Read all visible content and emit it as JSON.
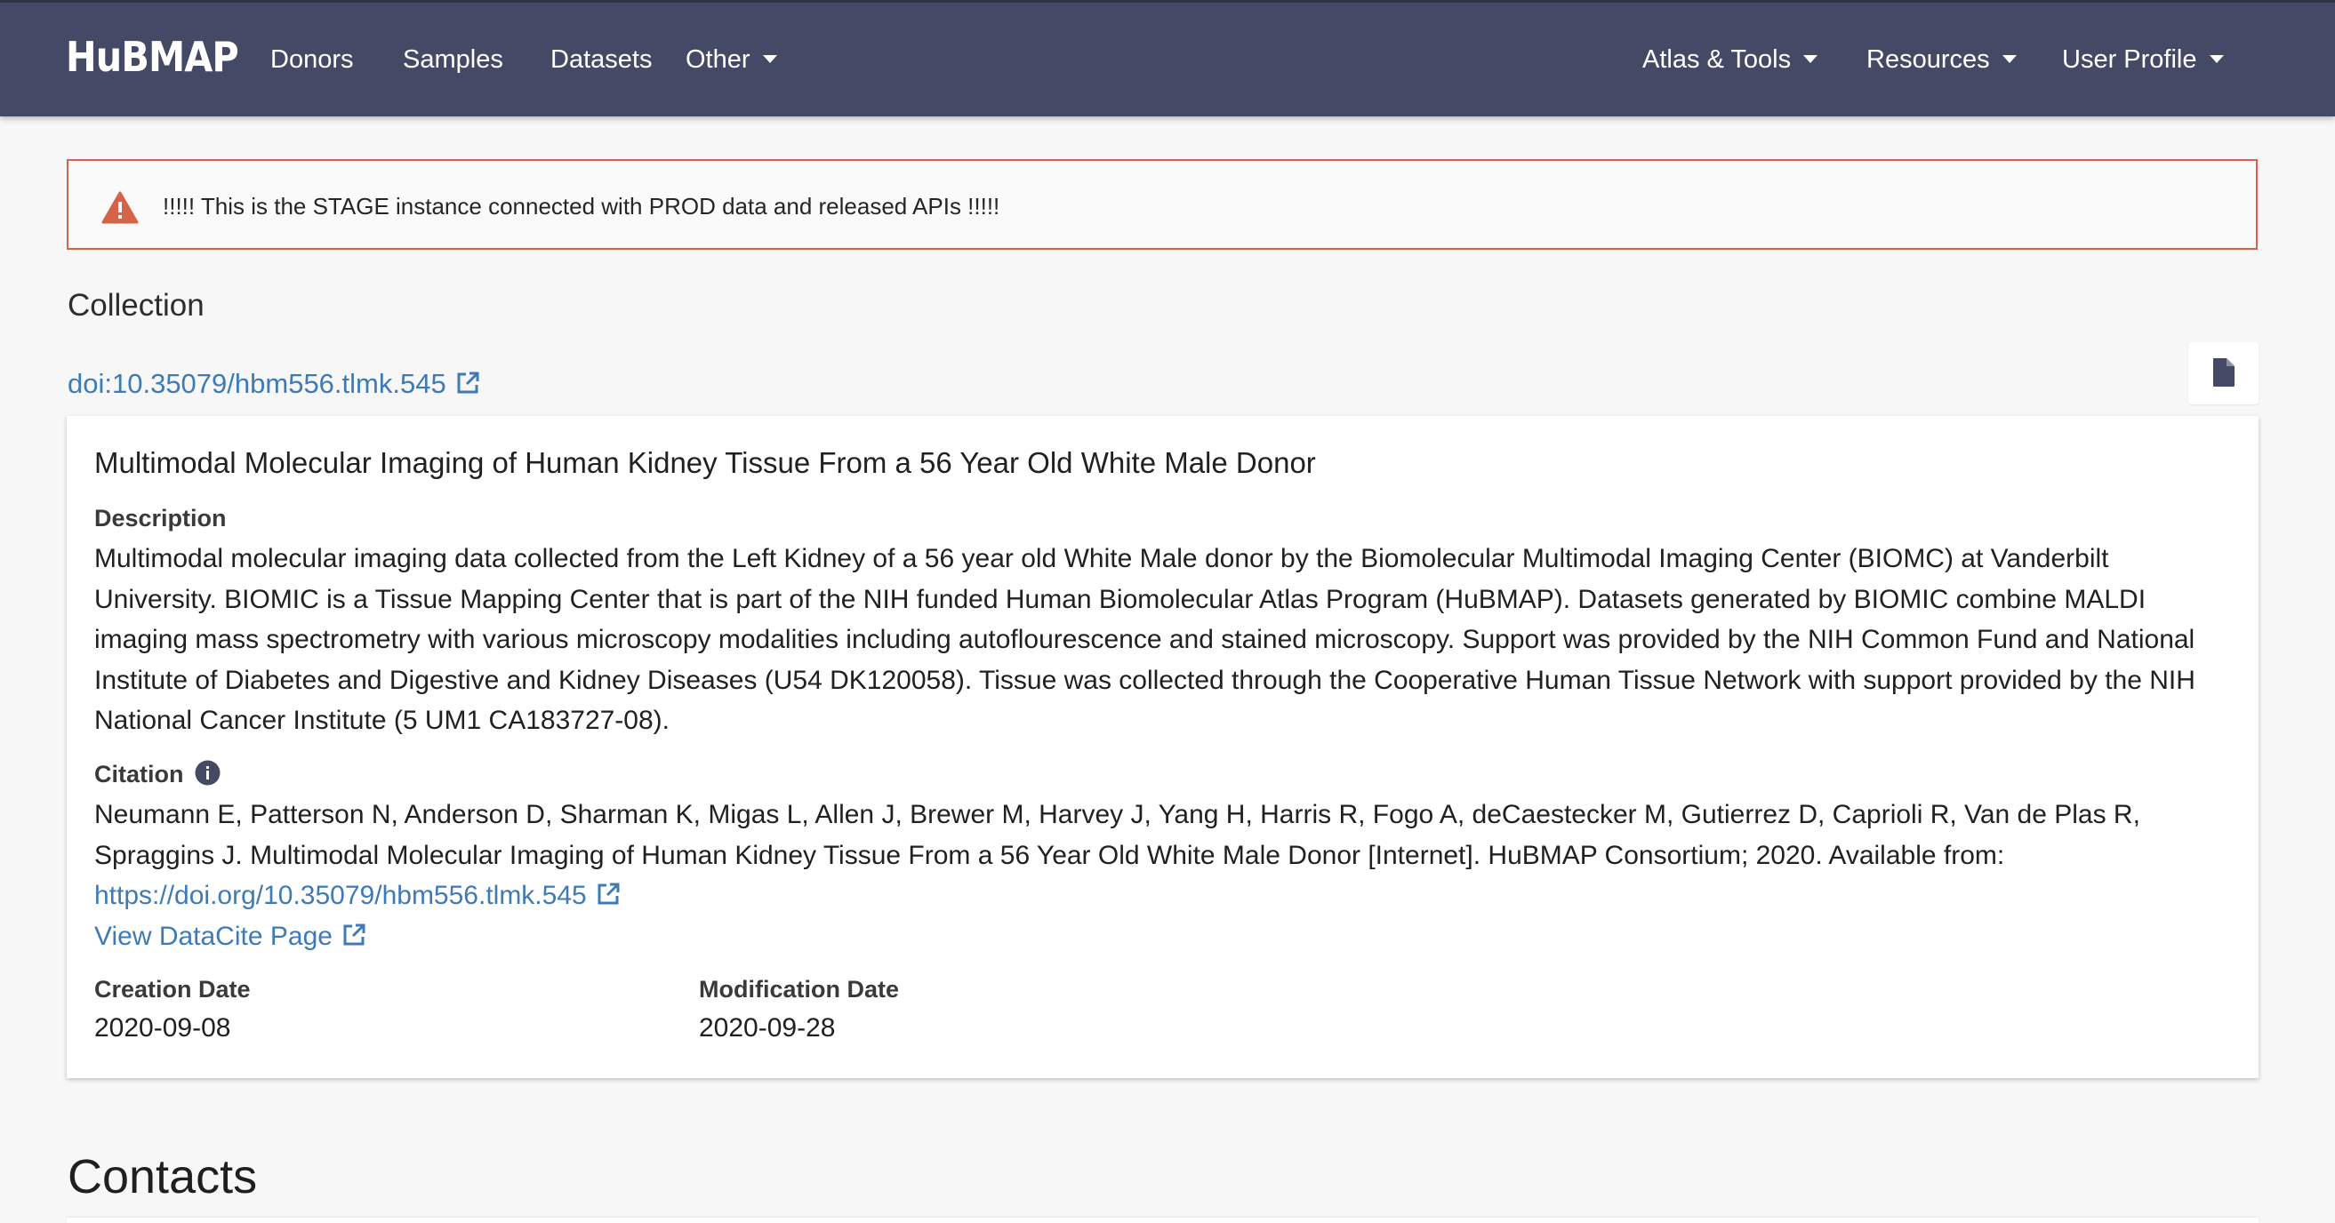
{
  "nav": {
    "logo": "HuBMAP",
    "left_items": [
      {
        "label": "Donors"
      },
      {
        "label": "Samples"
      },
      {
        "label": "Datasets"
      },
      {
        "label": "Other",
        "dropdown": true
      }
    ],
    "right_items": [
      {
        "label": "Atlas & Tools",
        "dropdown": true
      },
      {
        "label": "Resources",
        "dropdown": true
      },
      {
        "label": "User Profile",
        "dropdown": true
      }
    ]
  },
  "alert": {
    "text": "!!!!! This is the STAGE instance connected with PROD data and released APIs !!!!!",
    "icon": "warning-triangle-icon",
    "color": "#d4634a"
  },
  "page": {
    "section_label": "Collection",
    "doi": "doi:10.35079/hbm556.tlmk.545",
    "file_icon": "file-icon"
  },
  "card": {
    "title": "Multimodal Molecular Imaging of Human Kidney Tissue From a 56 Year Old White Male Donor",
    "description_label": "Description",
    "description": "Multimodal molecular imaging data collected from the Left Kidney of a 56 year old White Male donor by the Biomolecular Multimodal Imaging Center (BIOMC) at Vanderbilt University. BIOMIC is a Tissue Mapping Center that is part of the NIH funded Human Biomolecular Atlas Program (HuBMAP). Datasets generated by BIOMIC combine MALDI imaging mass spectrometry with various microscopy modalities including autoflourescence and stained microscopy. Support was provided by the NIH Common Fund and National Institute of Diabetes and Digestive and Kidney Diseases (U54 DK120058). Tissue was collected through the Cooperative Human Tissue Network with support provided by the NIH National Cancer Institute (5 UM1 CA183727-08).",
    "citation_label": "Citation",
    "citation_text": "Neumann E, Patterson N, Anderson D, Sharman K, Migas L, Allen J, Brewer M, Harvey J, Yang H, Harris R, Fogo A, deCaestecker M, Gutierrez D, Caprioli R, Van de Plas R, Spraggins J. Multimodal Molecular Imaging of Human Kidney Tissue From a 56 Year Old White Male Donor [Internet]. HuBMAP Consortium; 2020. Available from:",
    "citation_link": "https://doi.org/10.35079/hbm556.tlmk.545",
    "datacite_link": "View DataCite Page",
    "creation_label": "Creation Date",
    "creation_value": "2020-09-08",
    "modification_label": "Modification Date",
    "modification_value": "2020-09-28"
  },
  "contacts": {
    "heading": "Contacts"
  },
  "colors": {
    "navbar": "#444a65",
    "link": "#3e7bb6",
    "alert_border": "#d4634a"
  }
}
